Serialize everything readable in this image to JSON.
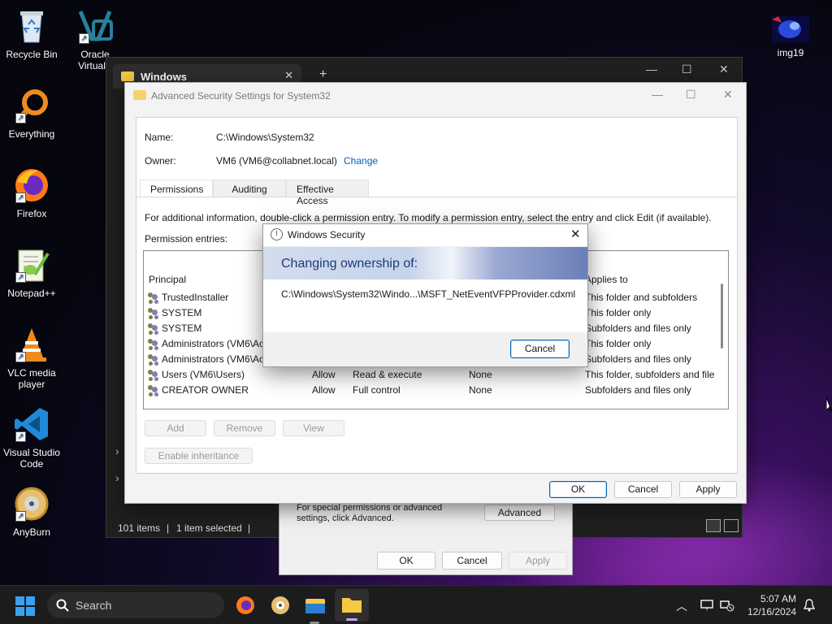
{
  "desktop": {
    "icons": [
      {
        "label": "Recycle Bin",
        "icon": "recycle-bin-icon"
      },
      {
        "label": "Oracle VirtualB",
        "icon": "virtualbox-icon"
      },
      {
        "label": "Everything",
        "icon": "everything-search-icon"
      },
      {
        "label": "Firefox",
        "icon": "firefox-icon"
      },
      {
        "label": "Notepad++",
        "icon": "notepadpp-icon"
      },
      {
        "label": "VLC media player",
        "icon": "vlc-icon"
      },
      {
        "label": "Visual Studio Code",
        "icon": "vscode-icon"
      },
      {
        "label": "AnyBurn",
        "icon": "anyburn-icon"
      },
      {
        "label": "img19",
        "icon": "image-file-icon"
      }
    ]
  },
  "explorer": {
    "tab_title": "Windows",
    "tab_close": "✕",
    "new_tab": "+",
    "status_items": "101 items",
    "status_selected": "1 item selected"
  },
  "properties_dialog": {
    "hint": "For special permissions or advanced settings, click Advanced.",
    "advanced": "Advanced",
    "ok": "OK",
    "cancel": "Cancel",
    "apply": "Apply"
  },
  "advanced_security": {
    "title": "Advanced Security Settings for System32",
    "name_label": "Name:",
    "name_value": "C:\\Windows\\System32",
    "owner_label": "Owner:",
    "owner_value": "VM6 (VM6@collabnet.local)",
    "change_link": "Change",
    "tabs": [
      "Permissions",
      "Auditing",
      "Effective Access"
    ],
    "info_text": "For additional information, double-click a permission entry. To modify a permission entry, select the entry and click Edit (if available).",
    "entries_label": "Permission entries:",
    "columns": {
      "principal": "Principal",
      "applies_to": "Applies to"
    },
    "rows": [
      {
        "principal": "TrustedInstaller",
        "type": "",
        "access": "",
        "inherited": "",
        "applies": "This folder and subfolders"
      },
      {
        "principal": "SYSTEM",
        "type": "",
        "access": "",
        "inherited": "",
        "applies": "This folder only"
      },
      {
        "principal": "SYSTEM",
        "type": "",
        "access": "",
        "inherited": "",
        "applies": "Subfolders and files only"
      },
      {
        "principal": "Administrators (VM6\\Ac",
        "type": "",
        "access": "",
        "inherited": "",
        "applies": "This folder only"
      },
      {
        "principal": "Administrators (VM6\\Ac",
        "type": "",
        "access": "",
        "inherited": "",
        "applies": "Subfolders and files only"
      },
      {
        "principal": "Users (VM6\\Users)",
        "type": "Allow",
        "access": "Read & execute",
        "inherited": "None",
        "applies": "This folder, subfolders and file"
      },
      {
        "principal": "CREATOR OWNER",
        "type": "Allow",
        "access": "Full control",
        "inherited": "None",
        "applies": "Subfolders and files only"
      }
    ],
    "add": "Add",
    "remove": "Remove",
    "view": "View",
    "enable_inheritance": "Enable inheritance",
    "ok": "OK",
    "cancel": "Cancel",
    "apply": "Apply"
  },
  "windows_security": {
    "title": "Windows Security",
    "heading": "Changing ownership of:",
    "path": "C:\\Windows\\System32\\Windo...\\MSFT_NetEventVFPProvider.cdxml",
    "cancel": "Cancel"
  },
  "taskbar": {
    "search_placeholder": "Search",
    "time": "5:07 AM",
    "date": "12/16/2024"
  }
}
